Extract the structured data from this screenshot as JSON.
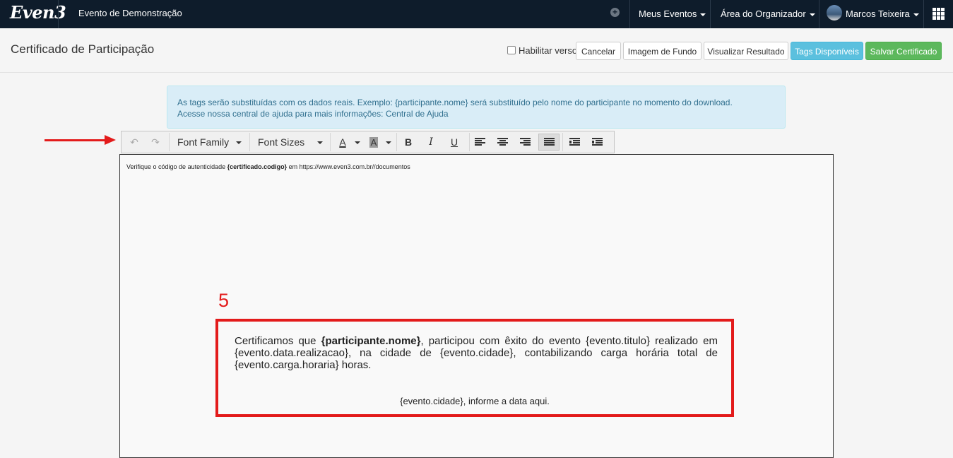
{
  "topbar": {
    "logo": "Even3",
    "event_name": "Evento de Demonstração",
    "meus_eventos": "Meus Eventos",
    "area_organizador": "Área do Organizador",
    "user_name": "Marcos Teixeira"
  },
  "header": {
    "title": "Certificado de Participação",
    "habilitar_verso": "Habilitar verso",
    "cancelar": "Cancelar",
    "imagem_fundo": "Imagem de Fundo",
    "visualizar": "Visualizar Resultado",
    "tags": "Tags Disponíveis",
    "salvar": "Salvar Certificado"
  },
  "alert": {
    "line1": "As tags serão substituídas com os dados reais. Exemplo: {participante.nome} será substituído pelo nome do participante no momento do download.",
    "line2_prefix": "Acesse nossa central de ajuda para mais informações: ",
    "line2_link": "Central de Ajuda"
  },
  "toolbar": {
    "undo": "↶",
    "redo": "↷",
    "font_family": "Font Family",
    "font_sizes": "Font Sizes",
    "text_color": "A",
    "bg_color": "A",
    "bold": "B",
    "italic": "I",
    "underline": "U"
  },
  "editor": {
    "verify_prefix": "Verifique o código de autenticidade ",
    "verify_tag": "{certificado.codigo}",
    "verify_suffix": " em https://www.even3.com.br//documentos",
    "annotation_number": "5",
    "para_prefix": "Certificamos que ",
    "para_tag": "{participante.nome}",
    "para_suffix": ", participou com êxito do evento {evento.titulo} realizado em {evento.data.realizacao}, na cidade de {evento.cidade}, contabilizando carga horária total de {evento.carga.horaria} horas.",
    "date_line": "{evento.cidade}, informe a data aqui."
  },
  "colors": {
    "navbar": "#0e1c2b",
    "annotation_red": "#e31b1b",
    "info_button": "#5bc0de",
    "success_button": "#5cb85c"
  },
  "icons": [
    "plus-circle-icon",
    "apps-grid-icon",
    "undo-icon",
    "redo-icon",
    "align-left-icon",
    "align-center-icon",
    "align-right-icon",
    "align-justify-icon",
    "outdent-icon",
    "indent-icon",
    "arrow-annotation"
  ]
}
